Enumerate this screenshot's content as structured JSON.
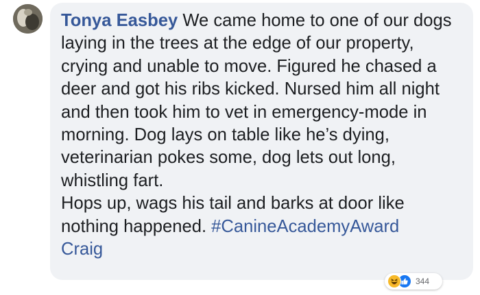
{
  "comment": {
    "author": "Tonya Easbey",
    "body_main": " We came home to one of our dogs laying in the trees at the edge of our property, crying and unable to move. Figured he chased a deer and got his ribs kicked. Nursed him all night and then took him to vet in emergency-mode in morning. Dog lays on table like he’s dying, veterinarian pokes some, dog lets out long, whistling fart.\nHops up, wags his tail and barks at door like nothing happened. ",
    "hashtag": "#CanineAcademyAward",
    "mention": "Craig"
  },
  "reactions": {
    "icons": [
      "haha-icon",
      "like-icon"
    ],
    "count": "344"
  },
  "colors": {
    "link": "#365899",
    "bubble": "#f0f2f5",
    "text": "#1c1e21"
  }
}
